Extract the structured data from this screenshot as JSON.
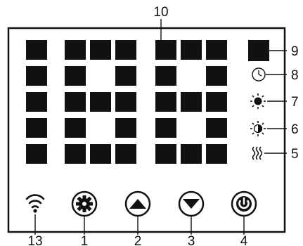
{
  "colors": {
    "ink": "#111111",
    "segment": "#111111",
    "background": "#ffffff"
  },
  "display": {
    "digits": [
      {
        "id": "digit-1",
        "cells_on": [
          0,
          3,
          6,
          9,
          12
        ]
      },
      {
        "id": "digit-2",
        "cells_on": [
          0,
          1,
          2,
          3,
          5,
          6,
          7,
          8,
          9,
          11,
          12,
          13,
          14
        ]
      },
      {
        "id": "digit-3",
        "cells_on": [
          0,
          1,
          2,
          3,
          5,
          6,
          7,
          8,
          9,
          11,
          12,
          13,
          14
        ]
      }
    ]
  },
  "indicators": [
    {
      "id": "status-square",
      "icon": "filled-square-icon",
      "callout": "9"
    },
    {
      "id": "timer",
      "icon": "clock-icon",
      "callout": "8"
    },
    {
      "id": "comfort-mode",
      "icon": "sun-icon",
      "callout": "7"
    },
    {
      "id": "eco-mode",
      "icon": "half-sun-icon",
      "callout": "6"
    },
    {
      "id": "heating",
      "icon": "heat-waves-icon",
      "callout": "5"
    }
  ],
  "buttons": [
    {
      "id": "wifi",
      "icon": "wifi-icon",
      "callout": "13"
    },
    {
      "id": "settings",
      "icon": "gear-icon",
      "callout": "1"
    },
    {
      "id": "up",
      "icon": "up-triangle-icon",
      "callout": "2"
    },
    {
      "id": "down",
      "icon": "down-triangle-icon",
      "callout": "3"
    },
    {
      "id": "power",
      "icon": "power-icon",
      "callout": "4"
    }
  ],
  "display_callout": "10"
}
